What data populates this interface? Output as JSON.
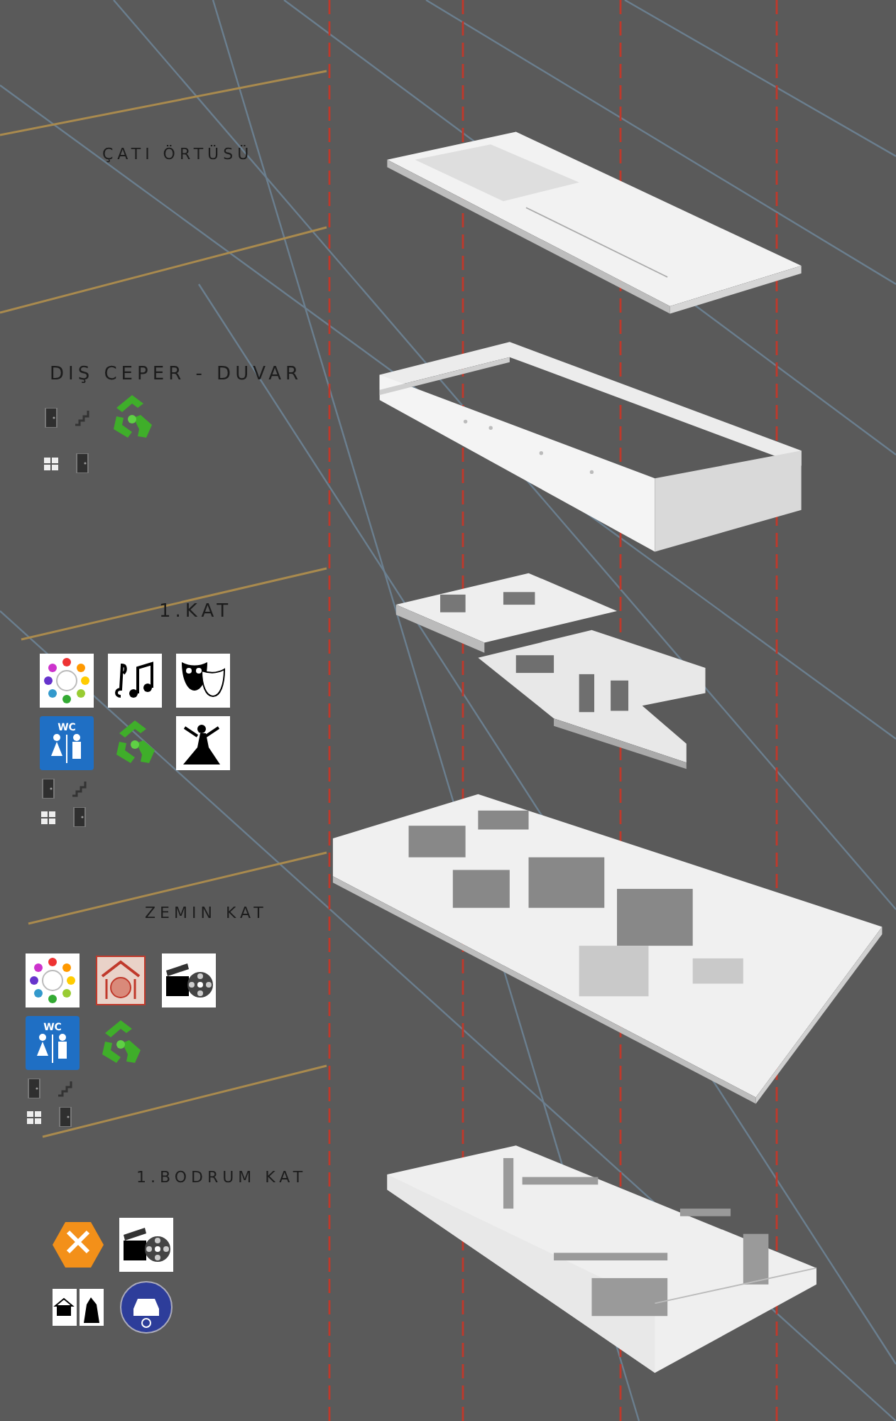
{
  "floors": [
    {
      "kind": "roof",
      "label": "ÇATI ÖRTÜSÜ"
    },
    {
      "kind": "walls",
      "label": "DIŞ CEPER - DUVAR",
      "icon_rows": [
        [
          {
            "kind": "door"
          },
          {
            "kind": "stair"
          },
          {
            "kind": "recycle"
          }
        ],
        [
          {
            "kind": "window"
          },
          {
            "kind": "door"
          }
        ]
      ]
    },
    {
      "kind": "upper",
      "label": "1.KAT",
      "icon_rows": [
        [
          {
            "kind": "community"
          },
          {
            "kind": "music"
          },
          {
            "kind": "theatre"
          }
        ],
        [
          {
            "kind": "wc",
            "text": "WC"
          },
          {
            "kind": "recycle"
          },
          {
            "kind": "dance"
          }
        ],
        [
          {
            "kind": "door"
          },
          {
            "kind": "stair"
          }
        ],
        [
          {
            "kind": "window"
          },
          {
            "kind": "door"
          }
        ]
      ]
    },
    {
      "kind": "ground",
      "label": "ZEMIN KAT",
      "icon_rows": [
        [
          {
            "kind": "community"
          },
          {
            "kind": "restaurant"
          },
          {
            "kind": "cinema"
          }
        ],
        [
          {
            "kind": "wc",
            "text": "WC"
          },
          {
            "kind": "recycle"
          }
        ],
        [
          {
            "kind": "door"
          },
          {
            "kind": "stair"
          }
        ],
        [
          {
            "kind": "window"
          },
          {
            "kind": "door"
          }
        ]
      ]
    },
    {
      "kind": "basement",
      "label": "1.BODRUM KAT",
      "icon_rows": [
        [
          {
            "kind": "support"
          },
          {
            "kind": "cinema"
          }
        ],
        [
          {
            "kind": "wardrobe"
          },
          {
            "kind": "parking"
          }
        ]
      ]
    }
  ]
}
